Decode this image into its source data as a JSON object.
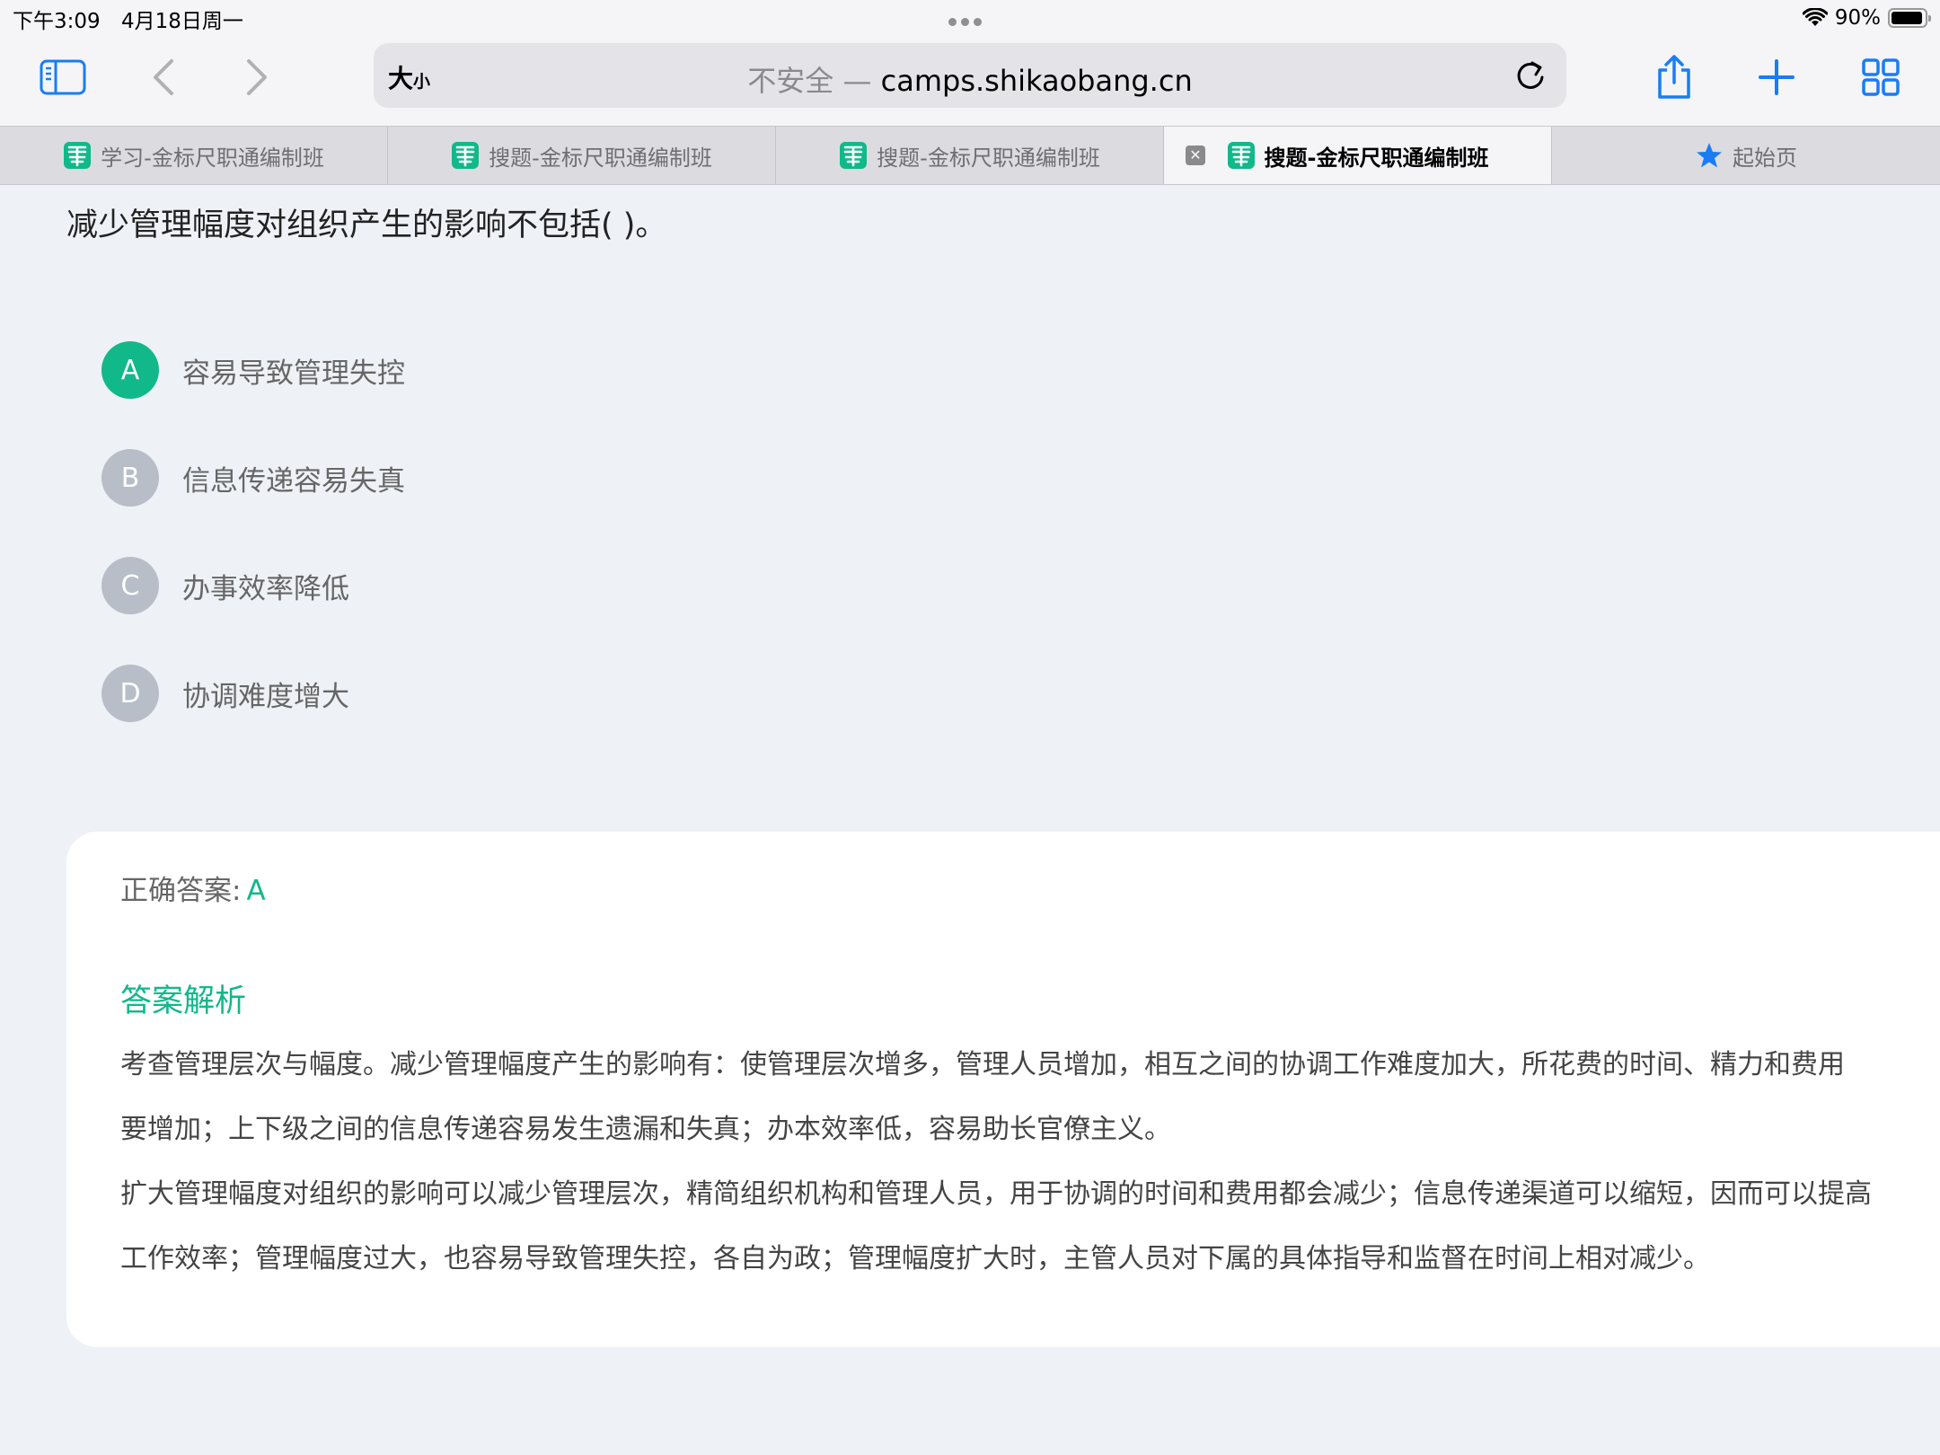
{
  "status_bar": {
    "time": "下午3:09",
    "date": "4月18日周一",
    "battery": "90%",
    "battery_level": 0.9
  },
  "toolbar": {
    "reader_label_big": "大",
    "reader_label_small": "小",
    "url_security": "不安全 —",
    "url_domain": "camps.shikaobang.cn"
  },
  "tabs": [
    {
      "label": "学习-金标尺职通编制班"
    },
    {
      "label": "搜题-金标尺职通编制班"
    },
    {
      "label": "搜题-金标尺职通编制班"
    },
    {
      "label": "搜题-金标尺职通编制班"
    },
    {
      "label": "起始页"
    }
  ],
  "question": {
    "text": "减少管理幅度对组织产生的影响不包括( )。",
    "options": [
      {
        "letter": "A",
        "text": "容易导致管理失控"
      },
      {
        "letter": "B",
        "text": "信息传递容易失真"
      },
      {
        "letter": "C",
        "text": "办事效率降低"
      },
      {
        "letter": "D",
        "text": "协调难度增大"
      }
    ]
  },
  "answer": {
    "label": "正确答案:",
    "value": "A",
    "analysis_title": "答案解析",
    "analysis_lines": [
      "考查管理层次与幅度。减少管理幅度产生的影响有：使管理层次增多，管理人员增加，相互之间的协调工作难度加大，所花费的时间、精力和费用",
      "要增加；上下级之间的信息传递容易发生遗漏和失真；办本效率低，容易助长官僚主义。",
      "扩大管理幅度对组织的影响可以减少管理层次，精简组织机构和管理人员，用于协调的时间和费用都会减少；信息传递渠道可以缩短，因而可以提高",
      "工作效率；管理幅度过大，也容易导致管理失控，各自为政；管理幅度扩大时，主管人员对下属的具体指导和监督在时间上相对减少。"
    ]
  },
  "colors": {
    "accent_green": "#11b88a",
    "ios_blue": "#1a7cf5",
    "option_gray": "#b8bec8"
  }
}
